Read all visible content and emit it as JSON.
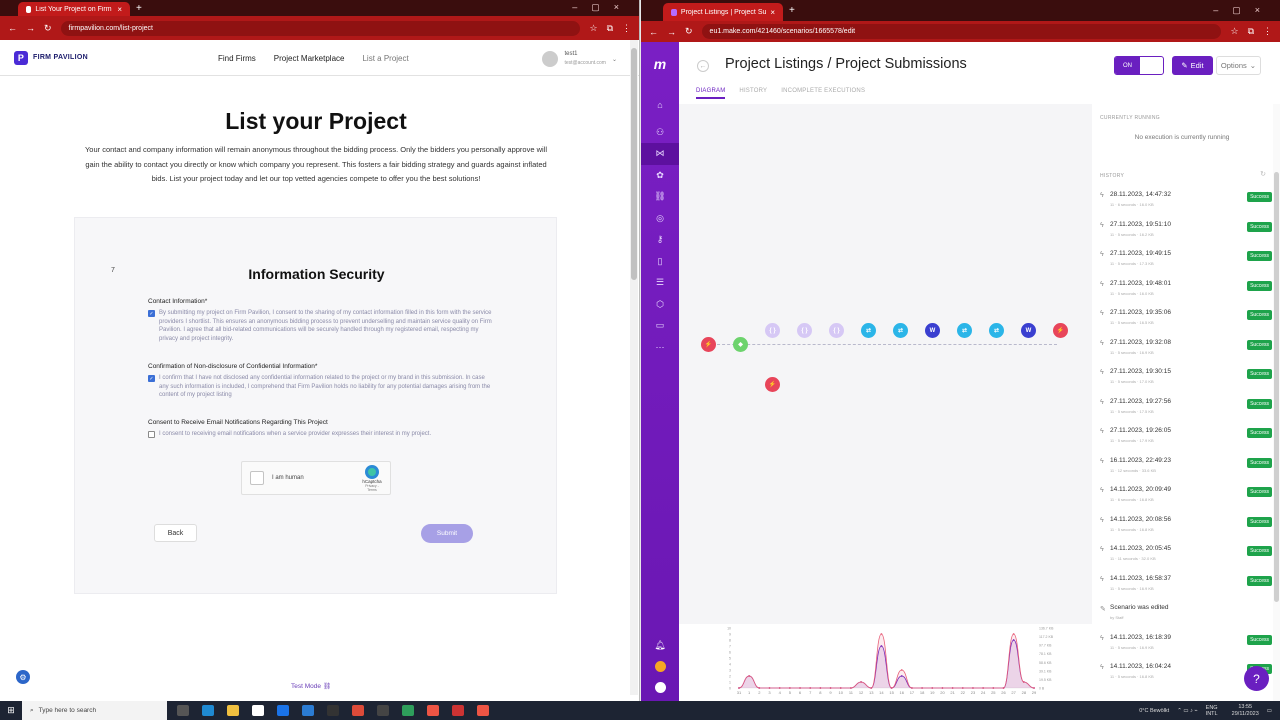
{
  "left_browser": {
    "tab_title": "List Your Project on Firm Pavilion",
    "url": "firmpavilion.com/list-project"
  },
  "site": {
    "brand": "FIRM PAVILION",
    "nav": [
      "Find Firms",
      "Project Marketplace",
      "List a Project"
    ],
    "account_name": "test1",
    "account_email": "test@account.com"
  },
  "page": {
    "title": "List your Project",
    "intro": "Your contact and company information will remain anonymous throughout the bidding process. Only the bidders you personally approve will gain the ability to contact you directly or know which company you represent. This fosters a fair bidding strategy and guards against inflated bids. List your project today and let our top vetted agencies compete to offer you the best solutions!",
    "step": "7",
    "section_title": "Information Security",
    "fields": [
      {
        "label": "Contact Information*",
        "checked": true,
        "text": "By submitting my project on Firm Pavilion, I consent to the sharing of my contact information filled in this form with the service providers I shortlist. This ensures an anonymous bidding process to prevent underselling and maintain service quality on Firm Pavilion. I agree that all bid-related communications will be securely handled through my registered email, respecting my privacy and project integrity."
      },
      {
        "label": "Confirmation of Non-disclosure of Confidential Information*",
        "checked": true,
        "text": "I confirm that I have not disclosed any confidential information related to the project or my brand in this submission. In case any such information is included, I comprehend that Firm Pavilion holds no liability for any potential damages arising from the content of my project listing"
      },
      {
        "label": "Consent to Receive Email Notifications Regarding This Project",
        "checked": false,
        "text": "I consent to receiving email notifications when a service provider expresses their interest in my project."
      }
    ],
    "captcha_label": "I am human",
    "captcha_brand": "hCaptcha",
    "captcha_links": "Privacy - Terms",
    "back_label": "Back",
    "submit_label": "Submit",
    "test_mode": "Test Mode"
  },
  "right_browser": {
    "tab_title": "Project Listings | Project Subm...",
    "url": "eu1.make.com/421460/scenarios/1665578/edit"
  },
  "make": {
    "title": "Project Listings / Project Submissions",
    "tabs": [
      "DIAGRAM",
      "HISTORY",
      "INCOMPLETE EXECUTIONS"
    ],
    "toggle_label": "ON",
    "edit_label": "Edit",
    "options_label": "Options",
    "currently_running_header": "CURRENTLY RUNNING",
    "no_execution": "No execution is currently running",
    "history_header": "HISTORY",
    "history": [
      {
        "date": "28.11.2023, 14:47:32",
        "meta": "11  ·  6 seconds  ·  16.0 KB",
        "status": "Success"
      },
      {
        "date": "27.11.2023, 19:51:10",
        "meta": "11  ·  5 seconds  ·  16.2 KB",
        "status": "Success"
      },
      {
        "date": "27.11.2023, 19:49:15",
        "meta": "11  ·  5 seconds  ·  17.3 KB",
        "status": "Success"
      },
      {
        "date": "27.11.2023, 19:48:01",
        "meta": "11  ·  5 seconds  ·  16.0 KB",
        "status": "Success"
      },
      {
        "date": "27.11.2023, 19:35:06",
        "meta": "11  ·  5 seconds  ·  16.5 KB",
        "status": "Success"
      },
      {
        "date": "27.11.2023, 19:32:08",
        "meta": "11  ·  5 seconds  ·  16.9 KB",
        "status": "Success"
      },
      {
        "date": "27.11.2023, 19:30:15",
        "meta": "11  ·  5 seconds  ·  17.0 KB",
        "status": "Success"
      },
      {
        "date": "27.11.2023, 19:27:56",
        "meta": "11  ·  5 seconds  ·  17.5 KB",
        "status": "Success"
      },
      {
        "date": "27.11.2023, 19:26:05",
        "meta": "11  ·  5 seconds  ·  17.9 KB",
        "status": "Success"
      },
      {
        "date": "16.11.2023, 22:49:23",
        "meta": "11  ·  12 seconds  ·  33.6 KB",
        "status": "Success"
      },
      {
        "date": "14.11.2023, 20:09:49",
        "meta": "11  ·  6 seconds  ·  16.8 KB",
        "status": "Success"
      },
      {
        "date": "14.11.2023, 20:08:56",
        "meta": "11  ·  5 seconds  ·  16.8 KB",
        "status": "Success"
      },
      {
        "date": "14.11.2023, 20:05:45",
        "meta": "11  ·  11 seconds  ·  32.0 KB",
        "status": "Success"
      },
      {
        "date": "14.11.2023, 16:58:37",
        "meta": "11  ·  5 seconds  ·  16.9 KB",
        "status": "Success"
      },
      {
        "date": "Scenario was edited",
        "meta": "by Staff",
        "status": ""
      },
      {
        "date": "14.11.2023, 16:18:39",
        "meta": "11  ·  5 seconds  ·  16.9 KB",
        "status": "Success"
      },
      {
        "date": "14.11.2023, 16:04:24",
        "meta": "11  ·  5 seconds  ·  16.8 KB",
        "status": "Success"
      }
    ],
    "chart_y_left": [
      "10",
      "9",
      "8",
      "7",
      "6",
      "5",
      "4",
      "3",
      "2",
      "1",
      "0"
    ],
    "chart_y_right": [
      "136.7 KB",
      "117.2 KB",
      "97.7 KB",
      "78.1 KB",
      "58.6 KB",
      "39.1 KB",
      "19.5 KB",
      "0 B"
    ],
    "chart_x": [
      "31",
      "1",
      "2",
      "3",
      "4",
      "5",
      "6",
      "7",
      "8",
      "9",
      "10",
      "11",
      "12",
      "13",
      "14",
      "15",
      "16",
      "17",
      "18",
      "19",
      "20",
      "21",
      "22",
      "23",
      "24",
      "25",
      "26",
      "27",
      "28",
      "29"
    ]
  },
  "chart_data": {
    "type": "area",
    "x": [
      "31",
      "1",
      "2",
      "3",
      "4",
      "5",
      "6",
      "7",
      "8",
      "9",
      "10",
      "11",
      "12",
      "13",
      "14",
      "15",
      "16",
      "17",
      "18",
      "19",
      "20",
      "21",
      "22",
      "23",
      "24",
      "25",
      "26",
      "27",
      "28",
      "29"
    ],
    "series": [
      {
        "values": [
          0,
          2,
          0,
          0,
          0,
          0,
          0,
          0,
          0,
          0,
          0,
          0,
          1,
          0,
          7,
          0,
          2,
          0,
          0,
          0,
          0,
          0,
          0,
          0,
          0,
          0,
          0,
          8,
          1,
          0
        ]
      },
      {
        "values": [
          0,
          2,
          0,
          0,
          0,
          0,
          0,
          0,
          0,
          0,
          0,
          0,
          1,
          0,
          9,
          0,
          3,
          0,
          0,
          0,
          0,
          0,
          0,
          0,
          0,
          0,
          0,
          9,
          1,
          0
        ]
      }
    ],
    "ylim": [
      0,
      10
    ],
    "colors": [
      "#6a1fc0",
      "#e8607a"
    ]
  },
  "taskbar": {
    "search_placeholder": "Type here to search",
    "weather": "0°C  Bewölkt",
    "lang": "ENG INTL",
    "time": "13:55",
    "date": "29/11/2023"
  }
}
